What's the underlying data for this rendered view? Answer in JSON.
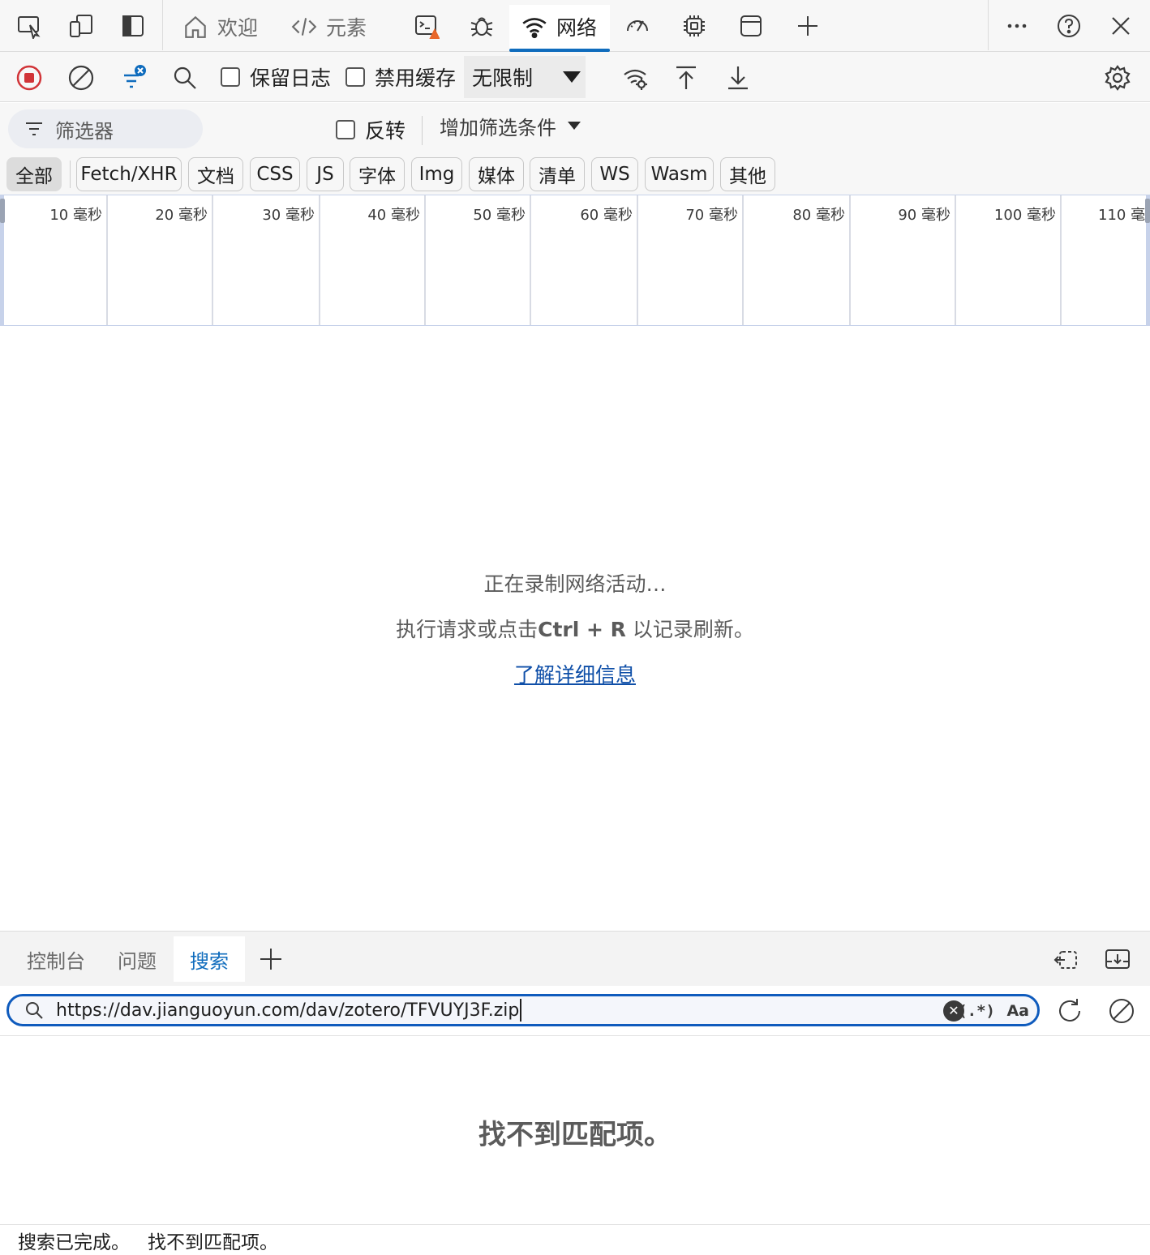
{
  "tabbar": {
    "tabs": [
      {
        "label": "欢迎",
        "icon": "home-icon"
      },
      {
        "label": "元素",
        "icon": "code-icon"
      },
      {
        "label": "",
        "icon": "console-warning-icon"
      },
      {
        "label": "",
        "icon": "bug-icon"
      },
      {
        "label": "网络",
        "icon": "wifi-icon",
        "active": true
      },
      {
        "label": "",
        "icon": "performance-icon"
      },
      {
        "label": "",
        "icon": "memory-chip-icon"
      },
      {
        "label": "",
        "icon": "application-icon"
      }
    ]
  },
  "toolbar": {
    "preserve_log": "保留日志",
    "disable_cache": "禁用缓存",
    "throttle": "无限制"
  },
  "filter": {
    "placeholder": "筛选器",
    "invert": "反转",
    "add_filter": "增加筛选条件",
    "types": [
      "全部",
      "Fetch/XHR",
      "文档",
      "CSS",
      "JS",
      "字体",
      "Img",
      "媒体",
      "清单",
      "WS",
      "Wasm",
      "其他"
    ],
    "selected": "全部"
  },
  "overview": {
    "ticks": [
      "10 毫秒",
      "20 毫秒",
      "30 毫秒",
      "40 毫秒",
      "50 毫秒",
      "60 毫秒",
      "70 毫秒",
      "80 毫秒",
      "90 毫秒",
      "100 毫秒",
      "110 毫秒"
    ]
  },
  "empty_state": {
    "line1": "正在录制网络活动…",
    "line2_prefix": "执行请求或点击",
    "line2_key": "Ctrl + R",
    "line2_suffix": " 以记录刷新。",
    "learn_more": "了解详细信息"
  },
  "drawer": {
    "tabs": [
      "控制台",
      "问题",
      "搜索"
    ],
    "active_tab": "搜索",
    "search_value": "https://dav.jianguoyun.com/dav/zotero/TFVUYJ3F.zip",
    "regex_label": "(.*)",
    "case_label": "Aa",
    "no_match": "找不到匹配项。"
  },
  "status": {
    "done": "搜索已完成。",
    "result": "找不到匹配项。"
  },
  "colors": {
    "accent": "#0f6cbd",
    "record": "#d13438",
    "link": "#0f4fa8"
  }
}
